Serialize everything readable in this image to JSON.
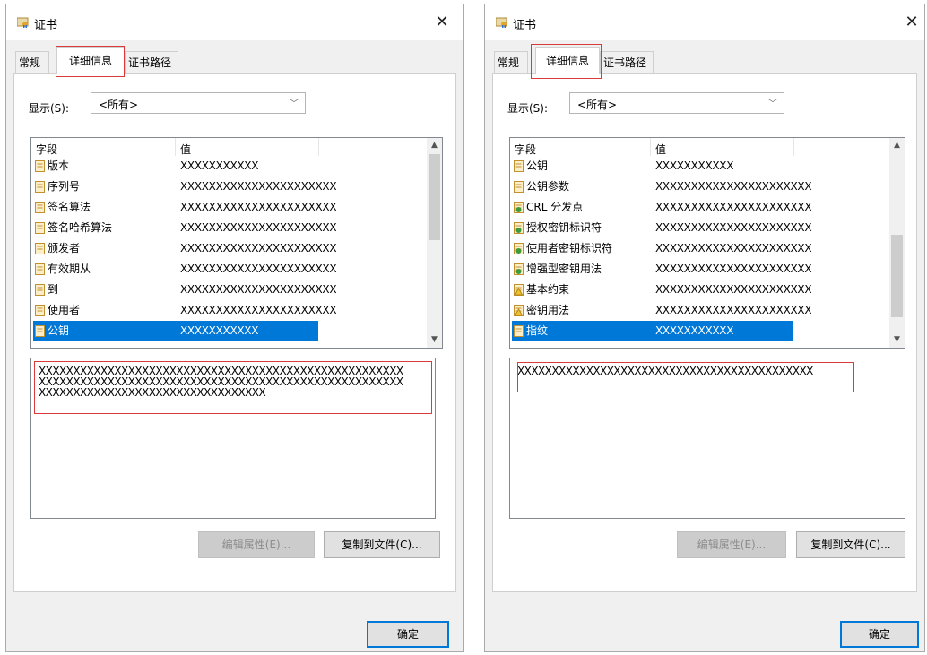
{
  "left": {
    "title": "证书",
    "tabs": [
      "常规",
      "详细信息",
      "证书路径"
    ],
    "show_label": "显示(S):",
    "show_value": "<所有>",
    "columns": [
      "字段",
      "值"
    ],
    "rows": [
      {
        "field": "版本",
        "value": "XXXXXXXXXXX"
      },
      {
        "field": "序列号",
        "value": "XXXXXXXXXXXXXXXXXXXXXX"
      },
      {
        "field": "签名算法",
        "value": "XXXXXXXXXXXXXXXXXXXXXX"
      },
      {
        "field": "签名哈希算法",
        "value": "XXXXXXXXXXXXXXXXXXXXXX"
      },
      {
        "field": "颁发者",
        "value": "XXXXXXXXXXXXXXXXXXXXXX"
      },
      {
        "field": "有效期从",
        "value": "XXXXXXXXXXXXXXXXXXXXXX"
      },
      {
        "field": "到",
        "value": "XXXXXXXXXXXXXXXXXXXXXX"
      },
      {
        "field": "使用者",
        "value": "XXXXXXXXXXXXXXXXXXXXXX"
      },
      {
        "field": "公钥",
        "value": "XXXXXXXXXXX"
      }
    ],
    "detail_text": "XXXXXXXXXXXXXXXXXXXXXXXXXXXXXXXXXXXXXXXXXXXXXXXXXXXXX\nXXXXXXXXXXXXXXXXXXXXXXXXXXXXXXXXXXXXXXXXXXXXXXXXXXXXX\nXXXXXXXXXXXXXXXXXXXXXXXXXXXXXXXXX",
    "edit_button": "编辑属性(E)...",
    "copy_button": "复制到文件(C)...",
    "ok_button": "确定"
  },
  "right": {
    "title": "证书",
    "tabs": [
      "常规",
      "详细信息",
      "证书路径"
    ],
    "show_label": "显示(S):",
    "show_value": "<所有>",
    "columns": [
      "字段",
      "值"
    ],
    "rows": [
      {
        "field": "公钥",
        "value": "XXXXXXXXXXX"
      },
      {
        "field": "公钥参数",
        "value": "XXXXXXXXXXXXXXXXXXXXXX"
      },
      {
        "field": "CRL 分发点",
        "value": "XXXXXXXXXXXXXXXXXXXXXX"
      },
      {
        "field": "授权密钥标识符",
        "value": "XXXXXXXXXXXXXXXXXXXXXX"
      },
      {
        "field": "使用者密钥标识符",
        "value": "XXXXXXXXXXXXXXXXXXXXXX"
      },
      {
        "field": "增强型密钥用法",
        "value": "XXXXXXXXXXXXXXXXXXXXXX"
      },
      {
        "field": "基本约束",
        "value": "XXXXXXXXXXXXXXXXXXXXXX"
      },
      {
        "field": "密钥用法",
        "value": "XXXXXXXXXXXXXXXXXXXXXX"
      },
      {
        "field": "指纹",
        "value": "XXXXXXXXXXX"
      }
    ],
    "detail_text": "XXXXXXXXXXXXXXXXXXXXXXXXXXXXXXXXXXXXXXXXXXX",
    "edit_button": "编辑属性(E)...",
    "copy_button": "复制到文件(C)...",
    "ok_button": "确定"
  },
  "colors": {
    "selection": "#0078d7",
    "highlight_box": "#d93a3a",
    "dialog_bg": "#f0f0f0"
  },
  "icons": [
    "certificate-icon",
    "close-icon",
    "field-doc-icon",
    "extension-icon",
    "critical-extension-icon"
  ]
}
